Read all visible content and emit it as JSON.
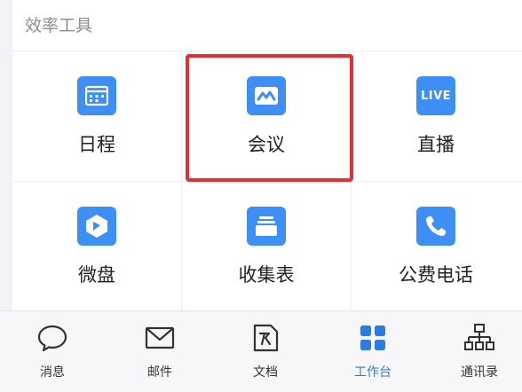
{
  "section": {
    "title": "效率工具"
  },
  "tools": [
    {
      "label": "日程",
      "icon": "calendar-icon"
    },
    {
      "label": "会议",
      "icon": "meeting-icon"
    },
    {
      "label": "直播",
      "icon": "live-icon",
      "icon_text": "LIVE"
    },
    {
      "label": "微盘",
      "icon": "drive-icon"
    },
    {
      "label": "收集表",
      "icon": "form-collection-icon"
    },
    {
      "label": "公费电话",
      "icon": "phone-icon"
    }
  ],
  "highlight": {
    "target": "会议",
    "color": "#ea2b2f"
  },
  "tabbar": {
    "items": [
      {
        "label": "消息",
        "icon": "chat-bubble-icon"
      },
      {
        "label": "邮件",
        "icon": "mail-icon"
      },
      {
        "label": "文档",
        "icon": "document-icon"
      },
      {
        "label": "工作台",
        "icon": "workbench-grid-icon",
        "active": true
      },
      {
        "label": "通讯录",
        "icon": "contacts-org-icon"
      }
    ]
  },
  "colors": {
    "accent": "#2c7be5",
    "icon_bg": "#3d8ef5"
  }
}
